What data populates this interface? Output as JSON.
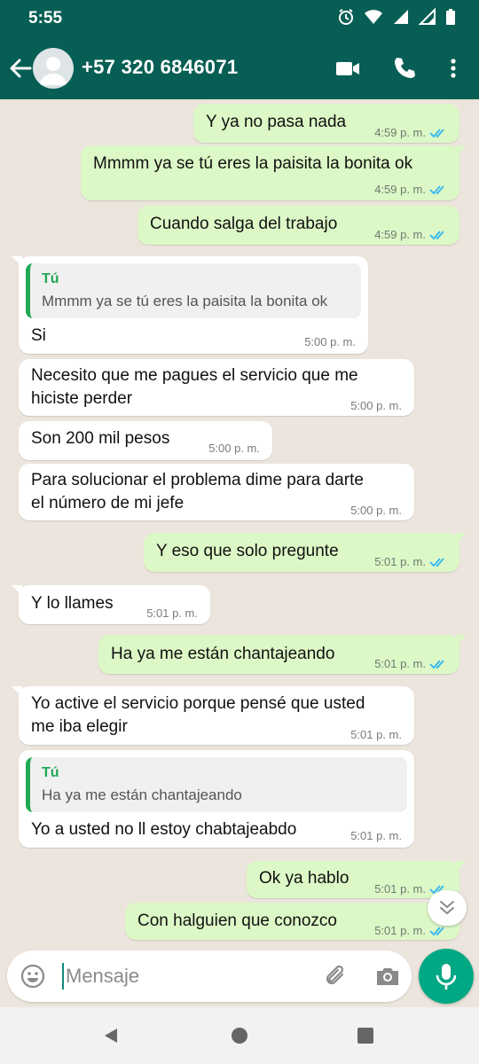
{
  "status_bar": {
    "time": "5:55"
  },
  "header": {
    "contact_name": "+57 320 6846071"
  },
  "colors": {
    "header": "#075E54",
    "outgoing_bubble": "#DCF8C6",
    "incoming_bubble": "#FFFFFF",
    "read_ticks": "#34B7F1",
    "accent": "#00A884"
  },
  "messages": [
    {
      "direction": "out",
      "text": "Y ya no pasa nada",
      "time": "4:59 p. m.",
      "read": true
    },
    {
      "direction": "out",
      "text": "Mmmm ya se tú eres la paisita la bonita ok",
      "time": "4:59 p. m.",
      "read": true
    },
    {
      "direction": "out",
      "text": "Cuando salga del trabajo",
      "time": "4:59 p. m.",
      "read": true
    },
    {
      "direction": "in",
      "quote": {
        "author": "Tú",
        "text": "Mmmm ya se tú eres la paisita la bonita ok"
      },
      "text": "Si",
      "time": "5:00 p. m."
    },
    {
      "direction": "in",
      "text_lines": [
        "Necesito que me pagues el servicio que me",
        "hiciste perder"
      ],
      "time": "5:00 p. m."
    },
    {
      "direction": "in",
      "text": "Son 200 mil pesos",
      "time": "5:00 p. m."
    },
    {
      "direction": "in",
      "text_lines": [
        "Para solucionar el problema dime para darte",
        "el número de mi jefe"
      ],
      "time": "5:00 p. m."
    },
    {
      "direction": "out",
      "text": "Y eso que solo pregunte",
      "time": "5:01 p. m.",
      "read": true
    },
    {
      "direction": "in",
      "text": "Y lo llames",
      "time": "5:01 p. m."
    },
    {
      "direction": "out",
      "text": "Ha ya me están chantajeando",
      "time": "5:01 p. m.",
      "read": true
    },
    {
      "direction": "in",
      "text_lines": [
        "Yo active el servicio porque pensé que usted",
        "me iba elegir"
      ],
      "time": "5:01 p. m."
    },
    {
      "direction": "in",
      "quote": {
        "author": "Tú",
        "text": "Ha ya me están chantajeando"
      },
      "text": "Yo a usted no ll estoy chabtajeabdo",
      "time": "5:01 p. m."
    },
    {
      "direction": "out",
      "text": "Ok ya hablo",
      "time": "5:01 p. m.",
      "read": true
    },
    {
      "direction": "out",
      "text": "Con halguien que conozco",
      "time": "5:01 p. m.",
      "read": true
    }
  ],
  "composer": {
    "placeholder": "Mensaje"
  },
  "icons": {
    "status": [
      "alarm-icon",
      "wifi-icon",
      "signal-icon",
      "signal-icon",
      "battery-icon"
    ],
    "header": [
      "back-arrow-icon",
      "avatar-icon",
      "video-call-icon",
      "phone-icon",
      "more-options-icon"
    ],
    "composer": [
      "emoji-icon",
      "attach-icon",
      "camera-icon",
      "mic-icon"
    ],
    "navigation": [
      "nav-back-icon",
      "nav-home-icon",
      "nav-recents-icon"
    ]
  }
}
